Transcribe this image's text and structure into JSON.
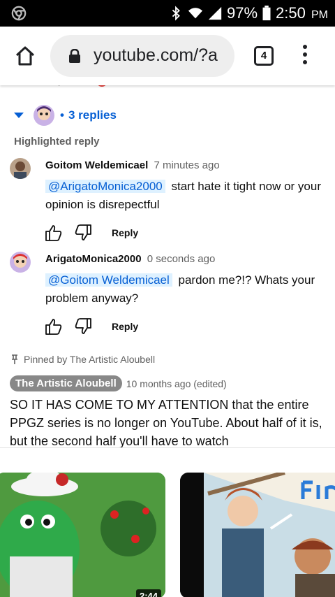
{
  "status_bar": {
    "battery": "97%",
    "time": "2:50",
    "ampm": "PM"
  },
  "browser": {
    "url": "youtube.com/?a",
    "tab_count": "4"
  },
  "thread": {
    "replies_label": "3 replies",
    "highlighted_label": "Highlighted reply"
  },
  "replies": [
    {
      "author": "Goitom Weldemicael",
      "time": "7 minutes ago",
      "mention": "@ArigatoMonica2000",
      "text": "start hate it tight now or your opinion is disrepectful",
      "reply_label": "Reply"
    },
    {
      "author": "ArigatoMonica2000",
      "time": "0 seconds ago",
      "mention": "@Goitom Weldemicael",
      "text": "pardon me?!? Whats your problem anyway?",
      "reply_label": "Reply"
    }
  ],
  "pinned": {
    "pinned_by": "Pinned by The Artistic Aloubell",
    "author": "The Artistic Aloubell",
    "time": "10 months ago (edited)",
    "text": "SO IT HAS COME TO MY ATTENTION that the entire PPGZ series is no longer on YouTube. About half of it is, but the second half you'll have to watch"
  },
  "videos": [
    {
      "duration": "2:44"
    },
    {
      "duration": ""
    }
  ],
  "colors": {
    "link_blue": "#065fd4",
    "mention_bg": "#def1ff",
    "muted": "#606060"
  }
}
